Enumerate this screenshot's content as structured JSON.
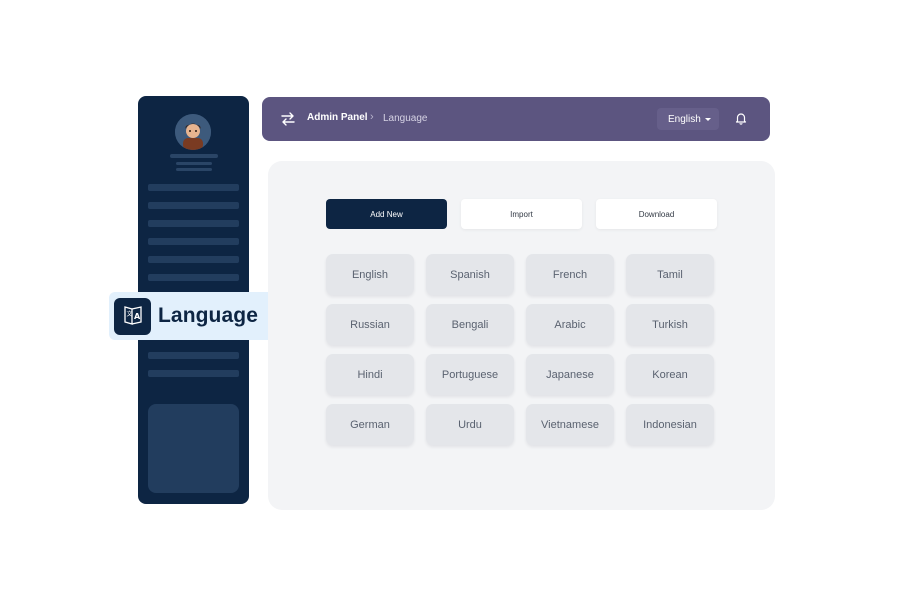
{
  "header": {
    "app_title": "Admin Panel",
    "breadcrumb_separator": "›",
    "current_page": "Language",
    "language_selector": {
      "selected": "English"
    }
  },
  "sidebar": {
    "highlight": {
      "label": "Language",
      "icon": "translate-icon"
    }
  },
  "actions": {
    "add_new": "Add New",
    "import": "Import",
    "download": "Download"
  },
  "languages": [
    "English",
    "Spanish",
    "French",
    "Tamil",
    "Russian",
    "Bengali",
    "Arabic",
    "Turkish",
    "Hindi",
    "Portuguese",
    "Japanese",
    "Korean",
    "German",
    "Urdu",
    "Vietnamese",
    "Indonesian"
  ],
  "colors": {
    "sidebar": "#0d2543",
    "header": "#5c5580",
    "primary_button": "#0d2543",
    "highlight_bg": "#e2f0fc"
  }
}
